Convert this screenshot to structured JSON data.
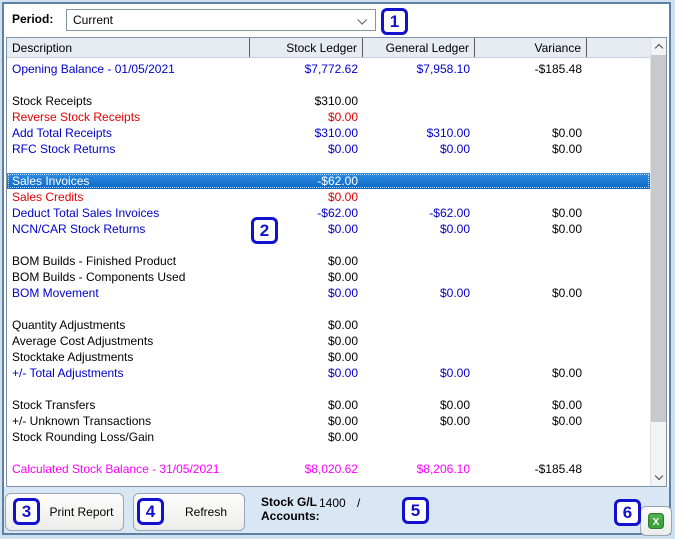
{
  "period": {
    "label": "Period:",
    "value": "Current"
  },
  "table": {
    "columns": [
      "Description",
      "Stock Ledger",
      "General Ledger",
      "Variance"
    ],
    "rows": [
      {
        "description": "Opening Balance - 01/05/2021",
        "stock_ledger": "$7,772.62",
        "general_ledger": "$7,958.10",
        "variance": "-$185.48",
        "style": "blue"
      },
      {
        "description": "",
        "stock_ledger": "",
        "general_ledger": "",
        "variance": "",
        "style": "black"
      },
      {
        "description": "Stock Receipts",
        "stock_ledger": "$310.00",
        "general_ledger": "",
        "variance": "",
        "style": "black"
      },
      {
        "description": "Reverse Stock Receipts",
        "stock_ledger": "$0.00",
        "general_ledger": "",
        "variance": "",
        "style": "red"
      },
      {
        "description": "Add Total Receipts",
        "stock_ledger": "$310.00",
        "general_ledger": "$310.00",
        "variance": "$0.00",
        "style": "blue"
      },
      {
        "description": "RFC Stock Returns",
        "stock_ledger": "$0.00",
        "general_ledger": "$0.00",
        "variance": "$0.00",
        "style": "blue"
      },
      {
        "description": "",
        "stock_ledger": "",
        "general_ledger": "",
        "variance": "",
        "style": "black"
      },
      {
        "description": "Sales Invoices",
        "stock_ledger": "-$62.00",
        "general_ledger": "",
        "variance": "",
        "style": "blue",
        "highlighted": true
      },
      {
        "description": "Sales Credits",
        "stock_ledger": "$0.00",
        "general_ledger": "",
        "variance": "",
        "style": "red"
      },
      {
        "description": "Deduct Total Sales Invoices",
        "stock_ledger": "-$62.00",
        "general_ledger": "-$62.00",
        "variance": "$0.00",
        "style": "blue"
      },
      {
        "description": "NCN/CAR Stock Returns",
        "stock_ledger": "$0.00",
        "general_ledger": "$0.00",
        "variance": "$0.00",
        "style": "blue"
      },
      {
        "description": "",
        "stock_ledger": "",
        "general_ledger": "",
        "variance": "",
        "style": "black"
      },
      {
        "description": "BOM Builds - Finished Product",
        "stock_ledger": "$0.00",
        "general_ledger": "",
        "variance": "",
        "style": "black"
      },
      {
        "description": "BOM Builds - Components Used",
        "stock_ledger": "$0.00",
        "general_ledger": "",
        "variance": "",
        "style": "black"
      },
      {
        "description": "BOM Movement",
        "stock_ledger": "$0.00",
        "general_ledger": "$0.00",
        "variance": "$0.00",
        "style": "blue"
      },
      {
        "description": "",
        "stock_ledger": "",
        "general_ledger": "",
        "variance": "",
        "style": "black"
      },
      {
        "description": "Quantity Adjustments",
        "stock_ledger": "$0.00",
        "general_ledger": "",
        "variance": "",
        "style": "black"
      },
      {
        "description": "Average Cost Adjustments",
        "stock_ledger": "$0.00",
        "general_ledger": "",
        "variance": "",
        "style": "black"
      },
      {
        "description": "Stocktake Adjustments",
        "stock_ledger": "$0.00",
        "general_ledger": "",
        "variance": "",
        "style": "black"
      },
      {
        "description": "+/- Total Adjustments",
        "stock_ledger": "$0.00",
        "general_ledger": "$0.00",
        "variance": "$0.00",
        "style": "blue"
      },
      {
        "description": "",
        "stock_ledger": "",
        "general_ledger": "",
        "variance": "",
        "style": "black"
      },
      {
        "description": "Stock Transfers",
        "stock_ledger": "$0.00",
        "general_ledger": "$0.00",
        "variance": "$0.00",
        "style": "black"
      },
      {
        "description": "+/- Unknown Transactions",
        "stock_ledger": "$0.00",
        "general_ledger": "$0.00",
        "variance": "$0.00",
        "style": "black"
      },
      {
        "description": "Stock Rounding Loss/Gain",
        "stock_ledger": "$0.00",
        "general_ledger": "",
        "variance": "",
        "style": "black"
      },
      {
        "description": "",
        "stock_ledger": "",
        "general_ledger": "",
        "variance": "",
        "style": "black"
      },
      {
        "description": "Calculated Stock Balance - 31/05/2021",
        "stock_ledger": "$8,020.62",
        "general_ledger": "$8,206.10",
        "variance": "-$185.48",
        "style": "magenta"
      }
    ]
  },
  "footer": {
    "print_report_label": "Print Report",
    "refresh_label": "Refresh",
    "stock_gl_label_line1": "Stock G/L",
    "stock_gl_label_line2": "Accounts:",
    "stock_gl_value": "1400",
    "stock_gl_separator": "/"
  },
  "annotations": [
    "1",
    "2",
    "3",
    "4",
    "5",
    "6"
  ],
  "colors": {
    "text_blue": "#0000cc",
    "text_red": "#e00000",
    "text_black": "#000000",
    "text_magenta": "#ff00ff",
    "highlight_bg": "#0a6cd6",
    "highlight_text": "#ffffff",
    "annotation_blue": "#1111ce",
    "excel_green": "#3da23d"
  }
}
